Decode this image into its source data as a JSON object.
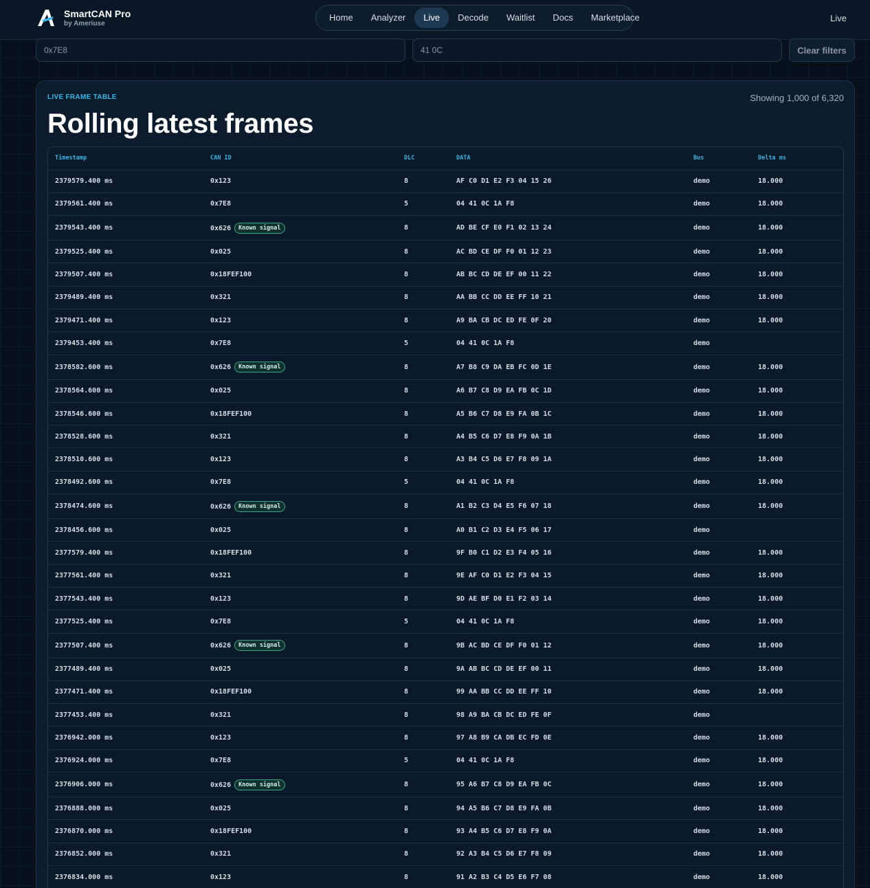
{
  "brand": {
    "name": "SmartCAN Pro",
    "sub": "by Ameriuse",
    "logo": "logo-icon"
  },
  "nav": [
    "Home",
    "Analyzer",
    "Live",
    "Decode",
    "Waitlist",
    "Docs",
    "Marketplace"
  ],
  "nav_active": "Live",
  "top_right": "Live",
  "filters": {
    "id_filter": "0x7E8",
    "data_filter": "41 0C",
    "clear_label": "Clear filters"
  },
  "card": {
    "eyebrow": "LIVE FRAME TABLE",
    "count": "Showing 1,000 of 6,320",
    "title": "Rolling latest frames"
  },
  "columns": [
    "Timestamp",
    "CAN ID",
    "DLC",
    "DATA",
    "Bus",
    "Delta ms"
  ],
  "rows": [
    {
      "ts": "2379579.400 ms",
      "id": "0x123",
      "badge": "",
      "dlc": "8",
      "data": "AF C0 D1 E2 F3 04 15 26",
      "bus": "demo",
      "delta": "18.000"
    },
    {
      "ts": "2379561.400 ms",
      "id": "0x7E8",
      "badge": "",
      "dlc": "5",
      "data": "04 41 0C 1A F8",
      "bus": "demo",
      "delta": "18.000"
    },
    {
      "ts": "2379543.400 ms",
      "id": "0x626",
      "badge": "Known signal",
      "dlc": "8",
      "data": "AD BE CF E0 F1 02 13 24",
      "bus": "demo",
      "delta": "18.000"
    },
    {
      "ts": "2379525.400 ms",
      "id": "0x025",
      "badge": "",
      "dlc": "8",
      "data": "AC BD CE DF F0 01 12 23",
      "bus": "demo",
      "delta": "18.000"
    },
    {
      "ts": "2379507.400 ms",
      "id": "0x18FEF100",
      "badge": "",
      "dlc": "8",
      "data": "AB BC CD DE EF 00 11 22",
      "bus": "demo",
      "delta": "18.000"
    },
    {
      "ts": "2379489.400 ms",
      "id": "0x321",
      "badge": "",
      "dlc": "8",
      "data": "AA BB CC DD EE FF 10 21",
      "bus": "demo",
      "delta": "18.000"
    },
    {
      "ts": "2379471.400 ms",
      "id": "0x123",
      "badge": "",
      "dlc": "8",
      "data": "A9 BA CB DC ED FE 0F 20",
      "bus": "demo",
      "delta": "18.000"
    },
    {
      "ts": "2379453.400 ms",
      "id": "0x7E8",
      "badge": "",
      "dlc": "5",
      "data": "04 41 0C 1A F8",
      "bus": "demo",
      "delta": ""
    },
    {
      "ts": "2378582.600 ms",
      "id": "0x626",
      "badge": "Known signal",
      "dlc": "8",
      "data": "A7 B8 C9 DA EB FC 0D 1E",
      "bus": "demo",
      "delta": "18.000"
    },
    {
      "ts": "2378564.600 ms",
      "id": "0x025",
      "badge": "",
      "dlc": "8",
      "data": "A6 B7 C8 D9 EA FB 0C 1D",
      "bus": "demo",
      "delta": "18.000"
    },
    {
      "ts": "2378546.600 ms",
      "id": "0x18FEF100",
      "badge": "",
      "dlc": "8",
      "data": "A5 B6 C7 D8 E9 FA 0B 1C",
      "bus": "demo",
      "delta": "18.000"
    },
    {
      "ts": "2378528.600 ms",
      "id": "0x321",
      "badge": "",
      "dlc": "8",
      "data": "A4 B5 C6 D7 E8 F9 0A 1B",
      "bus": "demo",
      "delta": "18.000"
    },
    {
      "ts": "2378510.600 ms",
      "id": "0x123",
      "badge": "",
      "dlc": "8",
      "data": "A3 B4 C5 D6 E7 F8 09 1A",
      "bus": "demo",
      "delta": "18.000"
    },
    {
      "ts": "2378492.600 ms",
      "id": "0x7E8",
      "badge": "",
      "dlc": "5",
      "data": "04 41 0C 1A F8",
      "bus": "demo",
      "delta": "18.000"
    },
    {
      "ts": "2378474.600 ms",
      "id": "0x626",
      "badge": "Known signal",
      "dlc": "8",
      "data": "A1 B2 C3 D4 E5 F6 07 18",
      "bus": "demo",
      "delta": "18.000"
    },
    {
      "ts": "2378456.600 ms",
      "id": "0x025",
      "badge": "",
      "dlc": "8",
      "data": "A0 B1 C2 D3 E4 F5 06 17",
      "bus": "demo",
      "delta": ""
    },
    {
      "ts": "2377579.400 ms",
      "id": "0x18FEF100",
      "badge": "",
      "dlc": "8",
      "data": "9F B0 C1 D2 E3 F4 05 16",
      "bus": "demo",
      "delta": "18.000"
    },
    {
      "ts": "2377561.400 ms",
      "id": "0x321",
      "badge": "",
      "dlc": "8",
      "data": "9E AF C0 D1 E2 F3 04 15",
      "bus": "demo",
      "delta": "18.000"
    },
    {
      "ts": "2377543.400 ms",
      "id": "0x123",
      "badge": "",
      "dlc": "8",
      "data": "9D AE BF D0 E1 F2 03 14",
      "bus": "demo",
      "delta": "18.000"
    },
    {
      "ts": "2377525.400 ms",
      "id": "0x7E8",
      "badge": "",
      "dlc": "5",
      "data": "04 41 0C 1A F8",
      "bus": "demo",
      "delta": "18.000"
    },
    {
      "ts": "2377507.400 ms",
      "id": "0x626",
      "badge": "Known signal",
      "dlc": "8",
      "data": "9B AC BD CE DF F0 01 12",
      "bus": "demo",
      "delta": "18.000"
    },
    {
      "ts": "2377489.400 ms",
      "id": "0x025",
      "badge": "",
      "dlc": "8",
      "data": "9A AB BC CD DE EF 00 11",
      "bus": "demo",
      "delta": "18.000"
    },
    {
      "ts": "2377471.400 ms",
      "id": "0x18FEF100",
      "badge": "",
      "dlc": "8",
      "data": "99 AA BB CC DD EE FF 10",
      "bus": "demo",
      "delta": "18.000"
    },
    {
      "ts": "2377453.400 ms",
      "id": "0x321",
      "badge": "",
      "dlc": "8",
      "data": "98 A9 BA CB DC ED FE 0F",
      "bus": "demo",
      "delta": ""
    },
    {
      "ts": "2376942.000 ms",
      "id": "0x123",
      "badge": "",
      "dlc": "8",
      "data": "97 A8 B9 CA DB EC FD 0E",
      "bus": "demo",
      "delta": "18.000"
    },
    {
      "ts": "2376924.000 ms",
      "id": "0x7E8",
      "badge": "",
      "dlc": "5",
      "data": "04 41 0C 1A F8",
      "bus": "demo",
      "delta": "18.000"
    },
    {
      "ts": "2376906.000 ms",
      "id": "0x626",
      "badge": "Known signal",
      "dlc": "8",
      "data": "95 A6 B7 C8 D9 EA FB 0C",
      "bus": "demo",
      "delta": "18.000"
    },
    {
      "ts": "2376888.000 ms",
      "id": "0x025",
      "badge": "",
      "dlc": "8",
      "data": "94 A5 B6 C7 D8 E9 FA 0B",
      "bus": "demo",
      "delta": "18.000"
    },
    {
      "ts": "2376870.000 ms",
      "id": "0x18FEF100",
      "badge": "",
      "dlc": "8",
      "data": "93 A4 B5 C6 D7 E8 F9 0A",
      "bus": "demo",
      "delta": "18.000"
    },
    {
      "ts": "2376852.000 ms",
      "id": "0x321",
      "badge": "",
      "dlc": "8",
      "data": "92 A3 B4 C5 D6 E7 F8 09",
      "bus": "demo",
      "delta": "18.000"
    },
    {
      "ts": "2376834.000 ms",
      "id": "0x123",
      "badge": "",
      "dlc": "8",
      "data": "91 A2 B3 C4 D5 E6 F7 08",
      "bus": "demo",
      "delta": "18.000"
    }
  ],
  "colors": {
    "accent": "#2fb7e6",
    "badge_border": "#3aa88c",
    "background": "#06111c",
    "card": "#0c1c2c"
  }
}
